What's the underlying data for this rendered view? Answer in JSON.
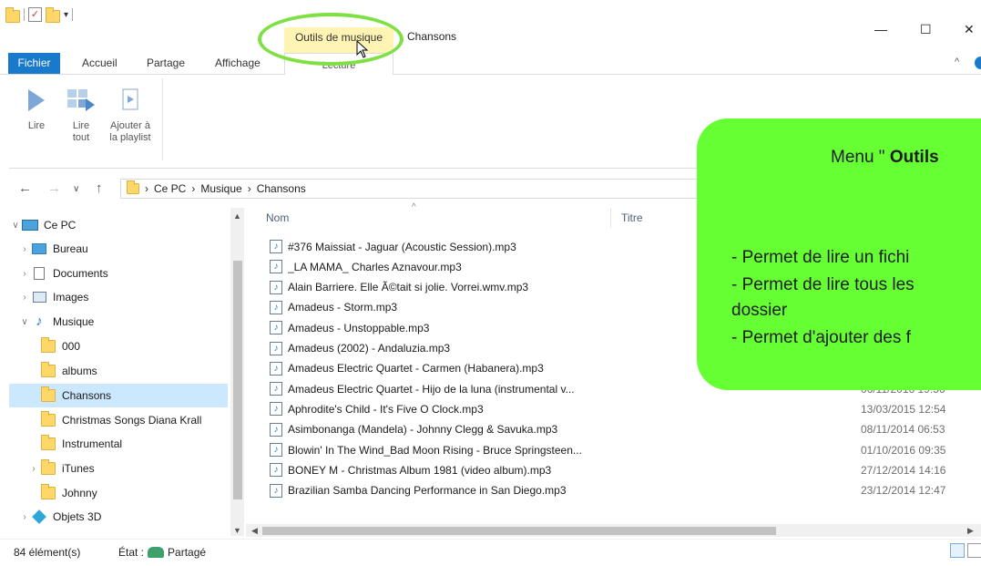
{
  "window": {
    "title": "Chansons",
    "context_tab_label": "Outils de musique",
    "controls": {
      "minimize": "—",
      "maximize": "☐",
      "close": "✕"
    }
  },
  "ribbon_tabs": {
    "fichier": "Fichier",
    "accueil": "Accueil",
    "partage": "Partage",
    "affichage": "Affichage",
    "lecture": "Lecture"
  },
  "ribbon": {
    "lire": "Lire",
    "lire_tout_line1": "Lire",
    "lire_tout_line2": "tout",
    "ajouter_line1": "Ajouter à",
    "ajouter_line2": "la playlist"
  },
  "address": {
    "crumbs": [
      "Ce PC",
      "Musique",
      "Chansons"
    ],
    "separator": "›"
  },
  "nav_tree": [
    {
      "label": "Ce PC",
      "icon": "pc-icon",
      "expand": "∨"
    },
    {
      "label": "Bureau",
      "icon": "desktop-icon",
      "expand": "›"
    },
    {
      "label": "Documents",
      "icon": "documents-icon",
      "expand": "›"
    },
    {
      "label": "Images",
      "icon": "images-icon",
      "expand": "›"
    },
    {
      "label": "Musique",
      "icon": "music-icon",
      "expand": "∨"
    },
    {
      "label": "000",
      "icon": "folder-icon",
      "expand": ""
    },
    {
      "label": "albums",
      "icon": "folder-icon",
      "expand": ""
    },
    {
      "label": "Chansons",
      "icon": "folder-icon",
      "expand": "",
      "selected": true
    },
    {
      "label": "Christmas Songs Diana Krall",
      "icon": "folder-icon",
      "expand": ""
    },
    {
      "label": "Instrumental",
      "icon": "folder-icon",
      "expand": ""
    },
    {
      "label": "iTunes",
      "icon": "folder-icon",
      "expand": "›"
    },
    {
      "label": "Johnny",
      "icon": "folder-icon",
      "expand": ""
    },
    {
      "label": "Objets 3D",
      "icon": "3d-objects-icon",
      "expand": "›"
    }
  ],
  "columns": {
    "nom": "Nom",
    "titre": "Titre"
  },
  "files": [
    {
      "name": "#376 Maissiat - Jaguar (Acoustic Session).mp3",
      "date": ""
    },
    {
      "name": "_LA MAMA_ Charles Aznavour.mp3",
      "date": ""
    },
    {
      "name": "Alain Barriere. Elle Ã©tait si jolie. Vorrei.wmv.mp3",
      "date": ""
    },
    {
      "name": "Amadeus - Storm.mp3",
      "date": ""
    },
    {
      "name": "Amadeus - Unstoppable.mp3",
      "date": ""
    },
    {
      "name": "Amadeus (2002) - Andaluzia.mp3",
      "date": ""
    },
    {
      "name": "Amadeus Electric Quartet - Carmen (Habanera).mp3",
      "date": ""
    },
    {
      "name": "Amadeus Electric Quartet - Hijo de la luna (instrumental v...",
      "date": "06/11/2016 19:56"
    },
    {
      "name": "Aphrodite's Child - It's Five O Clock.mp3",
      "date": "13/03/2015 12:54"
    },
    {
      "name": "Asimbonanga (Mandela) - Johnny Clegg & Savuka.mp3",
      "date": "08/11/2014 06:53"
    },
    {
      "name": "Blowin' In The Wind_Bad Moon Rising - Bruce Springsteen...",
      "date": "01/10/2016 09:35"
    },
    {
      "name": "BONEY M - Christmas Album 1981 (video album).mp3",
      "date": "27/12/2014 14:16"
    },
    {
      "name": "Brazilian Samba Dancing Performance in San Diego.mp3",
      "date": "23/12/2014 12:47"
    }
  ],
  "status": {
    "count": "84 élément(s)",
    "state_label": "État :",
    "state_value": "Partagé"
  },
  "callout": {
    "title_prefix": "Menu \"",
    "title_bold": "Outils",
    "line1": "- Permet de lire un fichi",
    "line2": "- Permet de lire tous les",
    "line3": "dossier",
    "line4": "- Permet d'ajouter des f"
  },
  "colors": {
    "accent": "#1979ca",
    "context_tab": "#fff4b3",
    "callout": "#66ff33",
    "highlight_ring": "#7ee043",
    "selection": "#cce8ff"
  }
}
